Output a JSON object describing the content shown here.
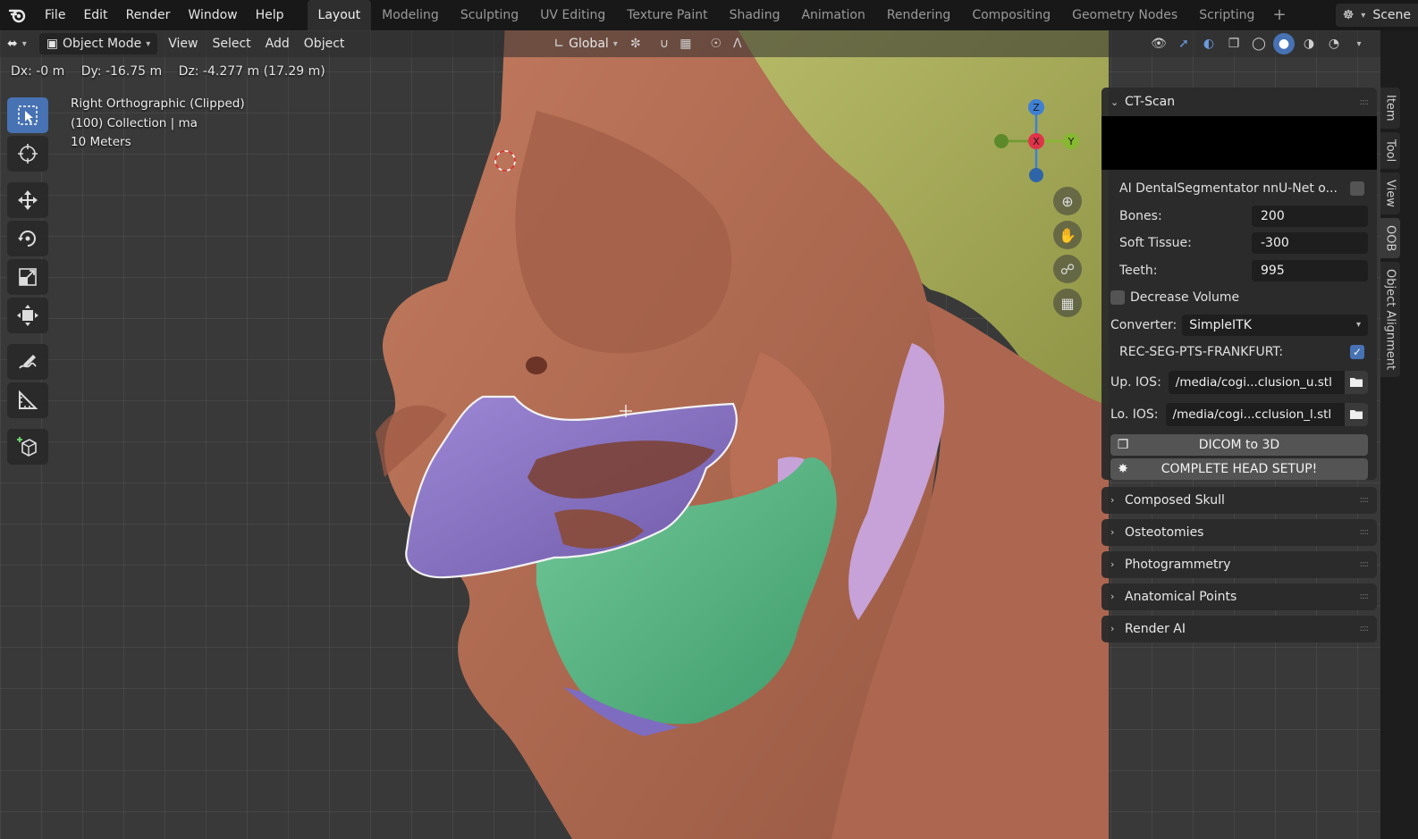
{
  "menu": {
    "items": [
      "File",
      "Edit",
      "Render",
      "Window",
      "Help"
    ]
  },
  "workspaces": {
    "tabs": [
      "Layout",
      "Modeling",
      "Sculpting",
      "UV Editing",
      "Texture Paint",
      "Shading",
      "Animation",
      "Rendering",
      "Compositing",
      "Geometry Nodes",
      "Scripting"
    ],
    "active": "Layout",
    "scene_label": "Scene"
  },
  "viewport_header": {
    "mode": "Object Mode",
    "menus": [
      "View",
      "Select",
      "Add",
      "Object"
    ],
    "orientation": "Global"
  },
  "status": {
    "dx": "Dx: -0 m",
    "dy": "Dy: -16.75 m",
    "dz": "Dz: -4.277 m (17.29 m)"
  },
  "viewport_info": {
    "view": "Right Orthographic (Clipped)",
    "collection": "(100) Collection | ma",
    "scale": "10 Meters"
  },
  "gizmo": {
    "x": "X",
    "y": "Y",
    "z": "Z"
  },
  "panel": {
    "title": "CT-Scan",
    "ai_label": "AI DentalSegmentator nnU-Net o...",
    "bones_label": "Bones:",
    "bones_value": "200",
    "soft_label": "Soft Tissue:",
    "soft_value": "-300",
    "teeth_label": "Teeth:",
    "teeth_value": "995",
    "decrease_label": "Decrease Volume",
    "converter_label": "Converter:",
    "converter_value": "SimpleITK",
    "rec_label": "REC-SEG-PTS-FRANKFURT:",
    "up_label": "Up. IOS:",
    "up_value": "/media/cogi...clusion_u.stl",
    "lo_label": "Lo. IOS:",
    "lo_value": "/media/cogi...cclusion_l.stl",
    "dicom_btn": "DICOM to 3D",
    "head_btn": "COMPLETE HEAD SETUP!"
  },
  "subpanels": [
    "Composed Skull",
    "Osteotomies",
    "Photogrammetry",
    "Anatomical Points",
    "Render AI"
  ],
  "side_tabs": [
    "Item",
    "Tool",
    "View",
    "OOB",
    "Object Alignment"
  ],
  "colors": {
    "accent": "#4772b3",
    "skin": "#b06a52",
    "bone": "#a8ad58",
    "upper_teeth": "#8d78c6",
    "lower_jaw": "#5fb88a",
    "muscle": "#b998cf"
  }
}
